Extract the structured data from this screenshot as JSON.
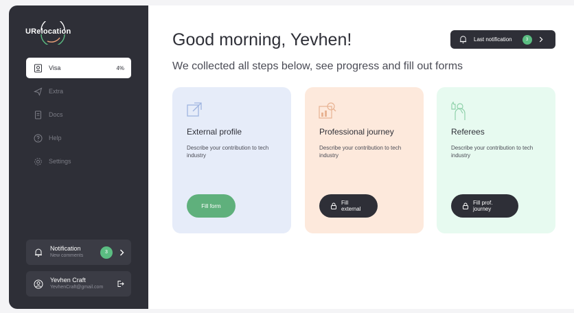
{
  "brand": {
    "logo_text": "URelocation"
  },
  "sidebar": {
    "items": [
      {
        "label": "Visa",
        "progress": "4%",
        "icon": "passport-icon",
        "active": true
      },
      {
        "label": "Extra",
        "icon": "send-icon"
      },
      {
        "label": "Docs",
        "icon": "document-icon"
      },
      {
        "label": "Help",
        "icon": "question-icon"
      },
      {
        "label": "Settings",
        "icon": "gear-icon"
      }
    ],
    "notification": {
      "title": "Notification",
      "subtitle": "New comments",
      "count": "3",
      "icon": "bell-icon"
    },
    "user": {
      "name": "Yevhen Craft",
      "email": "YevhenCraft@gmail.com",
      "icon": "user-icon"
    }
  },
  "main": {
    "greeting": "Good morning, Yevhen!",
    "subtitle": "We collected all steps below, see progress and fill out forms",
    "last_notification": {
      "label": "Last notification",
      "count": "3"
    },
    "cards": [
      {
        "title": "External profile",
        "description": "Describe your contribution to tech industry",
        "button": "Fill form",
        "bg": "#e6ecf9",
        "button_color": "#5fb07c",
        "icon": "external-link-icon"
      },
      {
        "title": "Professional journey",
        "description": "Describe your contribution to tech industry",
        "button": "Fill external",
        "bg": "#fde9dc",
        "button_color": "#2e2f37",
        "icon": "chart-magnifier-icon"
      },
      {
        "title": "Referees",
        "description": "Describe your contribution to tech industry",
        "button": "Fill prof. journey",
        "bg": "#e7faf0",
        "button_color": "#2e2f37",
        "icon": "thumbs-up-person-icon"
      }
    ]
  },
  "colors": {
    "accent_green": "#5bbd82",
    "dark": "#2e2f37"
  }
}
